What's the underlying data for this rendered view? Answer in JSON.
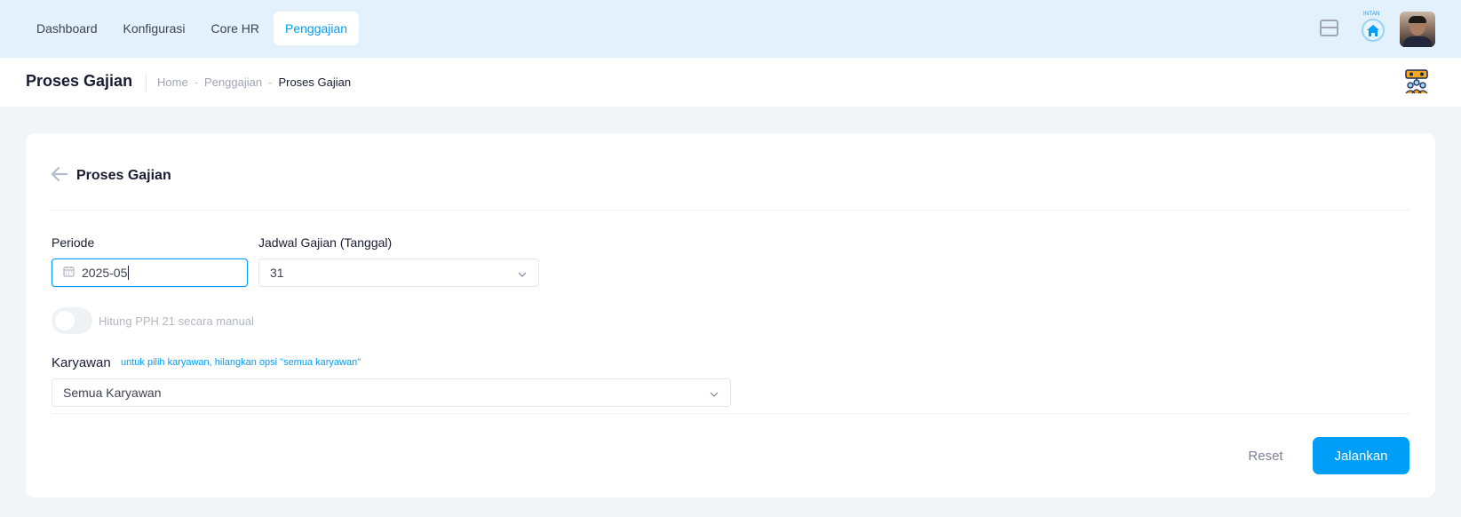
{
  "nav": {
    "items": [
      {
        "label": "Dashboard"
      },
      {
        "label": "Konfigurasi"
      },
      {
        "label": "Core HR"
      },
      {
        "label": "Penggajian"
      }
    ],
    "home_label": "INTAN"
  },
  "subheader": {
    "title": "Proses Gajian",
    "breadcrumb": [
      "Home",
      "Penggajian",
      "Proses Gajian"
    ]
  },
  "card": {
    "title": "Proses Gajian",
    "periode": {
      "label": "Periode",
      "value": "2025-05"
    },
    "jadwal": {
      "label": "Jadwal Gajian (Tanggal)",
      "value": "31"
    },
    "pph_toggle": {
      "label": "Hitung PPH 21 secara manual",
      "checked": false
    },
    "karyawan": {
      "label": "Karyawan",
      "hint": "untuk pilih karyawan, hilangkan opsi \"semua karyawan\"",
      "value": "Semua Karyawan"
    },
    "reset_label": "Reset",
    "run_label": "Jalankan"
  },
  "colors": {
    "primary": "#009ef7",
    "topbar_bg": "#e2f1fb",
    "page_bg": "#f3f4f7"
  }
}
